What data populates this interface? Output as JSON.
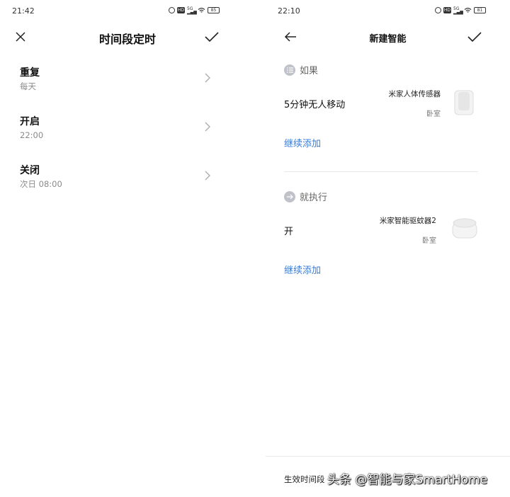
{
  "left": {
    "status_time": "21:42",
    "battery": "85",
    "title": "时间段定时",
    "rows": [
      {
        "title": "重复",
        "value": "每天"
      },
      {
        "title": "开启",
        "value": "22:00"
      },
      {
        "title": "关闭",
        "value": "次日 08:00"
      }
    ]
  },
  "right": {
    "status_time": "22:10",
    "battery": "81",
    "title": "新建智能",
    "if_label": "如果",
    "condition": {
      "text": "5分钟无人移动",
      "device": "米家人体传感器",
      "room": "卧室"
    },
    "add_more_1": "继续添加",
    "then_label": "就执行",
    "action": {
      "text": "开",
      "device": "米家智能驱蚊器2",
      "room": "卧室"
    },
    "add_more_2": "继续添加",
    "footer_label": "生效时间段"
  },
  "watermark": "头条 @智能与家SmartHome"
}
